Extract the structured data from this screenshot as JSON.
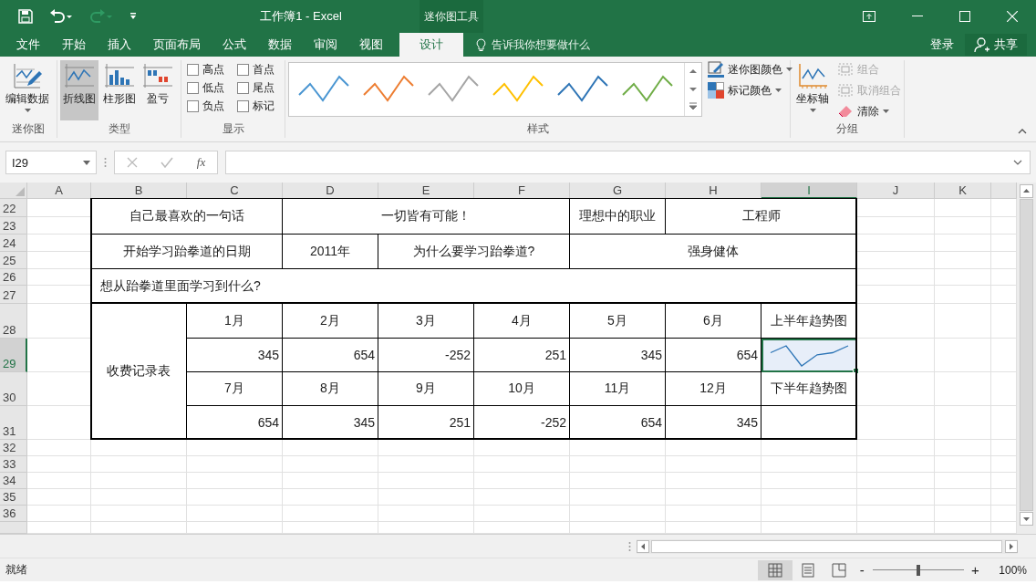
{
  "title_bar": {
    "title": "工作簿1 - Excel",
    "context_label": "迷你图工具"
  },
  "menu_tabs": [
    {
      "label": "文件",
      "selected": false
    },
    {
      "label": "开始",
      "selected": false
    },
    {
      "label": "插入",
      "selected": false
    },
    {
      "label": "页面布局",
      "selected": false
    },
    {
      "label": "公式",
      "selected": false
    },
    {
      "label": "数据",
      "selected": false
    },
    {
      "label": "审阅",
      "selected": false
    },
    {
      "label": "视图",
      "selected": false
    },
    {
      "label": "设计",
      "selected": true
    }
  ],
  "tell_me": "告诉我你想要做什么",
  "sign_in": "登录",
  "share": "共享",
  "ribbon": {
    "sparkline_group": {
      "edit_data": "编辑数据",
      "label": "迷你图"
    },
    "type_group": {
      "label": "类型",
      "buttons": [
        {
          "label": "折线图",
          "kind": "line",
          "selected": true
        },
        {
          "label": "柱形图",
          "kind": "column",
          "selected": false
        },
        {
          "label": "盈亏",
          "kind": "winloss",
          "selected": false
        }
      ]
    },
    "show_group": {
      "label": "显示",
      "options": [
        {
          "label": "高点",
          "checked": false
        },
        {
          "label": "首点",
          "checked": false
        },
        {
          "label": "低点",
          "checked": false
        },
        {
          "label": "尾点",
          "checked": false
        },
        {
          "label": "负点",
          "checked": false
        },
        {
          "label": "标记",
          "checked": false
        }
      ]
    },
    "style_group": {
      "label": "样式",
      "gallery": [
        {
          "color": "#4a96d2"
        },
        {
          "color": "#ed7d31"
        },
        {
          "color": "#a5a5a5"
        },
        {
          "color": "#ffc000"
        },
        {
          "color": "#2e75b6"
        },
        {
          "color": "#70ad47"
        }
      ],
      "sparkline_color": "迷你图颜色",
      "marker_color": "标记颜色"
    },
    "group_group": {
      "label": "分组",
      "axis": "坐标轴",
      "actions": [
        {
          "label": "组合",
          "kind": "group",
          "disabled": true
        },
        {
          "label": "取消组合",
          "kind": "ungroup",
          "disabled": true
        },
        {
          "label": "清除",
          "kind": "clear",
          "disabled": false
        }
      ]
    }
  },
  "formula_bar": {
    "name_box": "I29",
    "fx": "fx"
  },
  "sheet": {
    "columns": [
      {
        "label": "A",
        "selected": false
      },
      {
        "label": "B",
        "selected": false
      },
      {
        "label": "C",
        "selected": false
      },
      {
        "label": "D",
        "selected": false
      },
      {
        "label": "E",
        "selected": false
      },
      {
        "label": "F",
        "selected": false
      },
      {
        "label": "G",
        "selected": false
      },
      {
        "label": "H",
        "selected": false
      },
      {
        "label": "I",
        "selected": true
      },
      {
        "label": "J",
        "selected": false
      },
      {
        "label": "K",
        "selected": false
      }
    ],
    "rows": [
      {
        "label": "22",
        "selected": false
      },
      {
        "label": "23",
        "selected": false
      },
      {
        "label": "24",
        "selected": false
      },
      {
        "label": "25",
        "selected": false
      },
      {
        "label": "26",
        "selected": false
      },
      {
        "label": "27",
        "selected": false
      },
      {
        "label": "28",
        "selected": false
      },
      {
        "label": "29",
        "selected": true
      },
      {
        "label": "30",
        "selected": false
      },
      {
        "label": "31",
        "selected": false
      },
      {
        "label": "32",
        "selected": false
      },
      {
        "label": "33",
        "selected": false
      },
      {
        "label": "34",
        "selected": false
      },
      {
        "label": "35",
        "selected": false
      },
      {
        "label": "36",
        "selected": false
      }
    ],
    "info_cells": [
      {
        "text": "自己最喜欢的一句话",
        "kind": "center"
      },
      {
        "text": "一切皆有可能！",
        "kind": "center"
      },
      {
        "text": "理想中的职业",
        "kind": "center"
      },
      {
        "text": "工程师",
        "kind": "center"
      },
      {
        "text": "开始学习跆拳道的日期",
        "kind": "center"
      },
      {
        "text": "2011年",
        "kind": "center"
      },
      {
        "text": "为什么要学习跆拳道?",
        "kind": "center"
      },
      {
        "text": "强身健体",
        "kind": "center"
      },
      {
        "text": "想从跆拳道里面学习到什么?",
        "kind": "left"
      }
    ],
    "fee_table": {
      "title": "收费记录表",
      "halves": [
        {
          "months": [
            "1月",
            "2月",
            "3月",
            "4月",
            "5月",
            "6月"
          ],
          "amounts": [
            "345",
            "654",
            "-252",
            "251",
            "345",
            "654"
          ],
          "trend_label": "上半年趋势图",
          "sparkline": true,
          "selected": true
        },
        {
          "months": [
            "7月",
            "8月",
            "9月",
            "10月",
            "11月",
            "12月"
          ],
          "amounts": [
            "654",
            "345",
            "251",
            "-252",
            "654",
            "345"
          ],
          "trend_label": "下半年趋势图",
          "sparkline": false,
          "selected": false
        }
      ]
    }
  },
  "status_bar": {
    "status": "就绪",
    "zoom_out": "-",
    "zoom_in": "+",
    "zoom_slider": {
      "level": 0.5
    },
    "zoom": "100%"
  }
}
